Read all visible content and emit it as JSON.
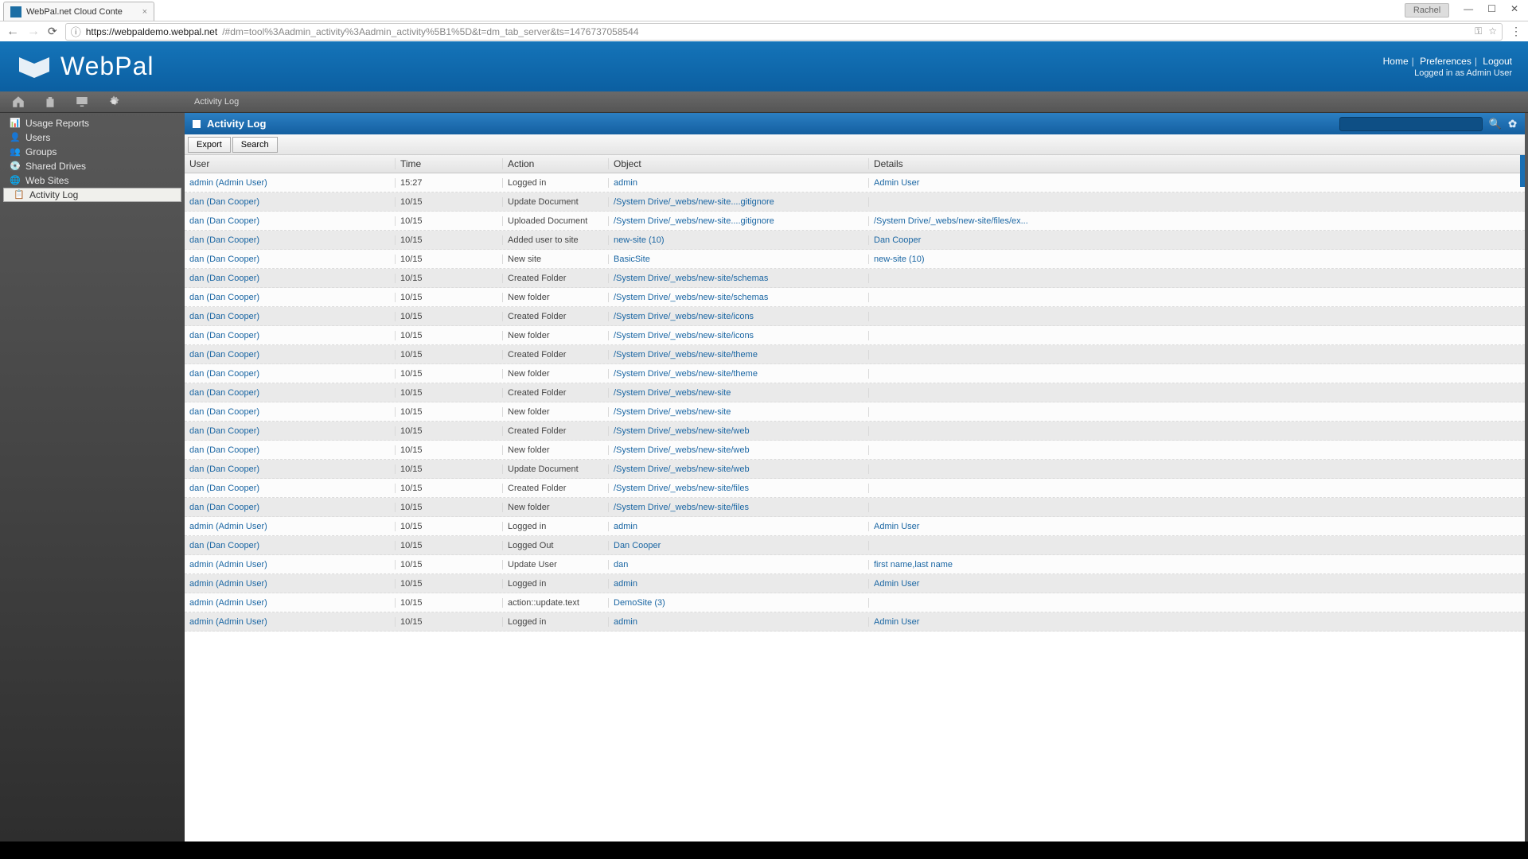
{
  "browser": {
    "tab_title": "WebPal.net Cloud Conte",
    "user_badge": "Rachel",
    "url_host": "https://webpaldemo.webpal.net",
    "url_rest": "/#dm=tool%3Aadmin_activity%3Aadmin_activity%5B1%5D&t=dm_tab_server&ts=1476737058544"
  },
  "header": {
    "brand": "WebPal",
    "links": {
      "home": "Home",
      "prefs": "Preferences",
      "logout": "Logout"
    },
    "logged_in": "Logged in as Admin User"
  },
  "sidebar": {
    "items": [
      {
        "label": "Usage Reports"
      },
      {
        "label": "Users"
      },
      {
        "label": "Groups"
      },
      {
        "label": "Shared Drives"
      },
      {
        "label": "Web Sites"
      },
      {
        "label": "Activity Log"
      }
    ]
  },
  "breadcrumb": "Activity Log",
  "panel": {
    "title": "Activity Log",
    "export": "Export",
    "search": "Search",
    "cols": {
      "user": "User",
      "time": "Time",
      "action": "Action",
      "object": "Object",
      "details": "Details"
    }
  },
  "rows": [
    {
      "user": "admin (Admin User)",
      "time": "15:27",
      "action": "Logged in",
      "object": "admin",
      "details": "Admin User"
    },
    {
      "user": "dan (Dan Cooper)",
      "time": "10/15",
      "action": "Update Document",
      "object": "/System Drive/_webs/new-site....gitignore",
      "details": ""
    },
    {
      "user": "dan (Dan Cooper)",
      "time": "10/15",
      "action": "Uploaded Document",
      "object": "/System Drive/_webs/new-site....gitignore",
      "details": "/System Drive/_webs/new-site/files/ex..."
    },
    {
      "user": "dan (Dan Cooper)",
      "time": "10/15",
      "action": "Added user to site",
      "object": "new-site (10)",
      "details": "Dan Cooper"
    },
    {
      "user": "dan (Dan Cooper)",
      "time": "10/15",
      "action": "New site",
      "object": "BasicSite",
      "details": "new-site (10)"
    },
    {
      "user": "dan (Dan Cooper)",
      "time": "10/15",
      "action": "Created Folder",
      "object": "/System Drive/_webs/new-site/schemas",
      "details": ""
    },
    {
      "user": "dan (Dan Cooper)",
      "time": "10/15",
      "action": "New folder",
      "object": "/System Drive/_webs/new-site/schemas",
      "details": ""
    },
    {
      "user": "dan (Dan Cooper)",
      "time": "10/15",
      "action": "Created Folder",
      "object": "/System Drive/_webs/new-site/icons",
      "details": ""
    },
    {
      "user": "dan (Dan Cooper)",
      "time": "10/15",
      "action": "New folder",
      "object": "/System Drive/_webs/new-site/icons",
      "details": ""
    },
    {
      "user": "dan (Dan Cooper)",
      "time": "10/15",
      "action": "Created Folder",
      "object": "/System Drive/_webs/new-site/theme",
      "details": ""
    },
    {
      "user": "dan (Dan Cooper)",
      "time": "10/15",
      "action": "New folder",
      "object": "/System Drive/_webs/new-site/theme",
      "details": ""
    },
    {
      "user": "dan (Dan Cooper)",
      "time": "10/15",
      "action": "Created Folder",
      "object": "/System Drive/_webs/new-site",
      "details": ""
    },
    {
      "user": "dan (Dan Cooper)",
      "time": "10/15",
      "action": "New folder",
      "object": "/System Drive/_webs/new-site",
      "details": ""
    },
    {
      "user": "dan (Dan Cooper)",
      "time": "10/15",
      "action": "Created Folder",
      "object": "/System Drive/_webs/new-site/web",
      "details": ""
    },
    {
      "user": "dan (Dan Cooper)",
      "time": "10/15",
      "action": "New folder",
      "object": "/System Drive/_webs/new-site/web",
      "details": ""
    },
    {
      "user": "dan (Dan Cooper)",
      "time": "10/15",
      "action": "Update Document",
      "object": "/System Drive/_webs/new-site/web",
      "details": ""
    },
    {
      "user": "dan (Dan Cooper)",
      "time": "10/15",
      "action": "Created Folder",
      "object": "/System Drive/_webs/new-site/files",
      "details": ""
    },
    {
      "user": "dan (Dan Cooper)",
      "time": "10/15",
      "action": "New folder",
      "object": "/System Drive/_webs/new-site/files",
      "details": ""
    },
    {
      "user": "admin (Admin User)",
      "time": "10/15",
      "action": "Logged in",
      "object": "admin",
      "details": "Admin User"
    },
    {
      "user": "dan (Dan Cooper)",
      "time": "10/15",
      "action": "Logged Out",
      "object": "Dan Cooper",
      "details": ""
    },
    {
      "user": "admin (Admin User)",
      "time": "10/15",
      "action": "Update User",
      "object": "dan",
      "details": "first name,last name"
    },
    {
      "user": "admin (Admin User)",
      "time": "10/15",
      "action": "Logged in",
      "object": "admin",
      "details": "Admin User"
    },
    {
      "user": "admin (Admin User)",
      "time": "10/15",
      "action": "action::update.text",
      "object": "DemoSite (3)",
      "details": ""
    },
    {
      "user": "admin (Admin User)",
      "time": "10/15",
      "action": "Logged in",
      "object": "admin",
      "details": "Admin User"
    }
  ]
}
